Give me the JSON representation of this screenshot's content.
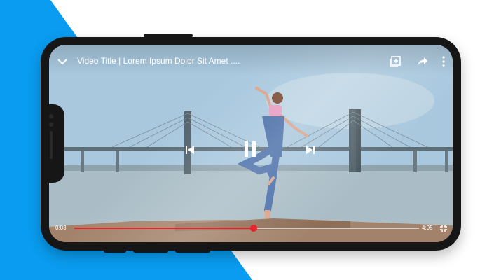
{
  "player": {
    "title": "Video Title | Lorem Ipsum Dolor Sit Amet ....",
    "current_time": "0:03",
    "duration": "4:05",
    "progress": 0.52,
    "is_playing": true
  },
  "icons": {
    "collapse": "chevron-down-icon",
    "add_to_queue": "add-to-queue-icon",
    "share": "share-icon",
    "more": "more-vertical-icon",
    "previous": "skip-previous-icon",
    "pause": "pause-icon",
    "next": "skip-next-icon",
    "fullscreen_exit": "fullscreen-exit-icon"
  },
  "colors": {
    "accent_red": "#e8232b",
    "background_blue": "#0a9cf0",
    "phone_frame": "#161616"
  }
}
